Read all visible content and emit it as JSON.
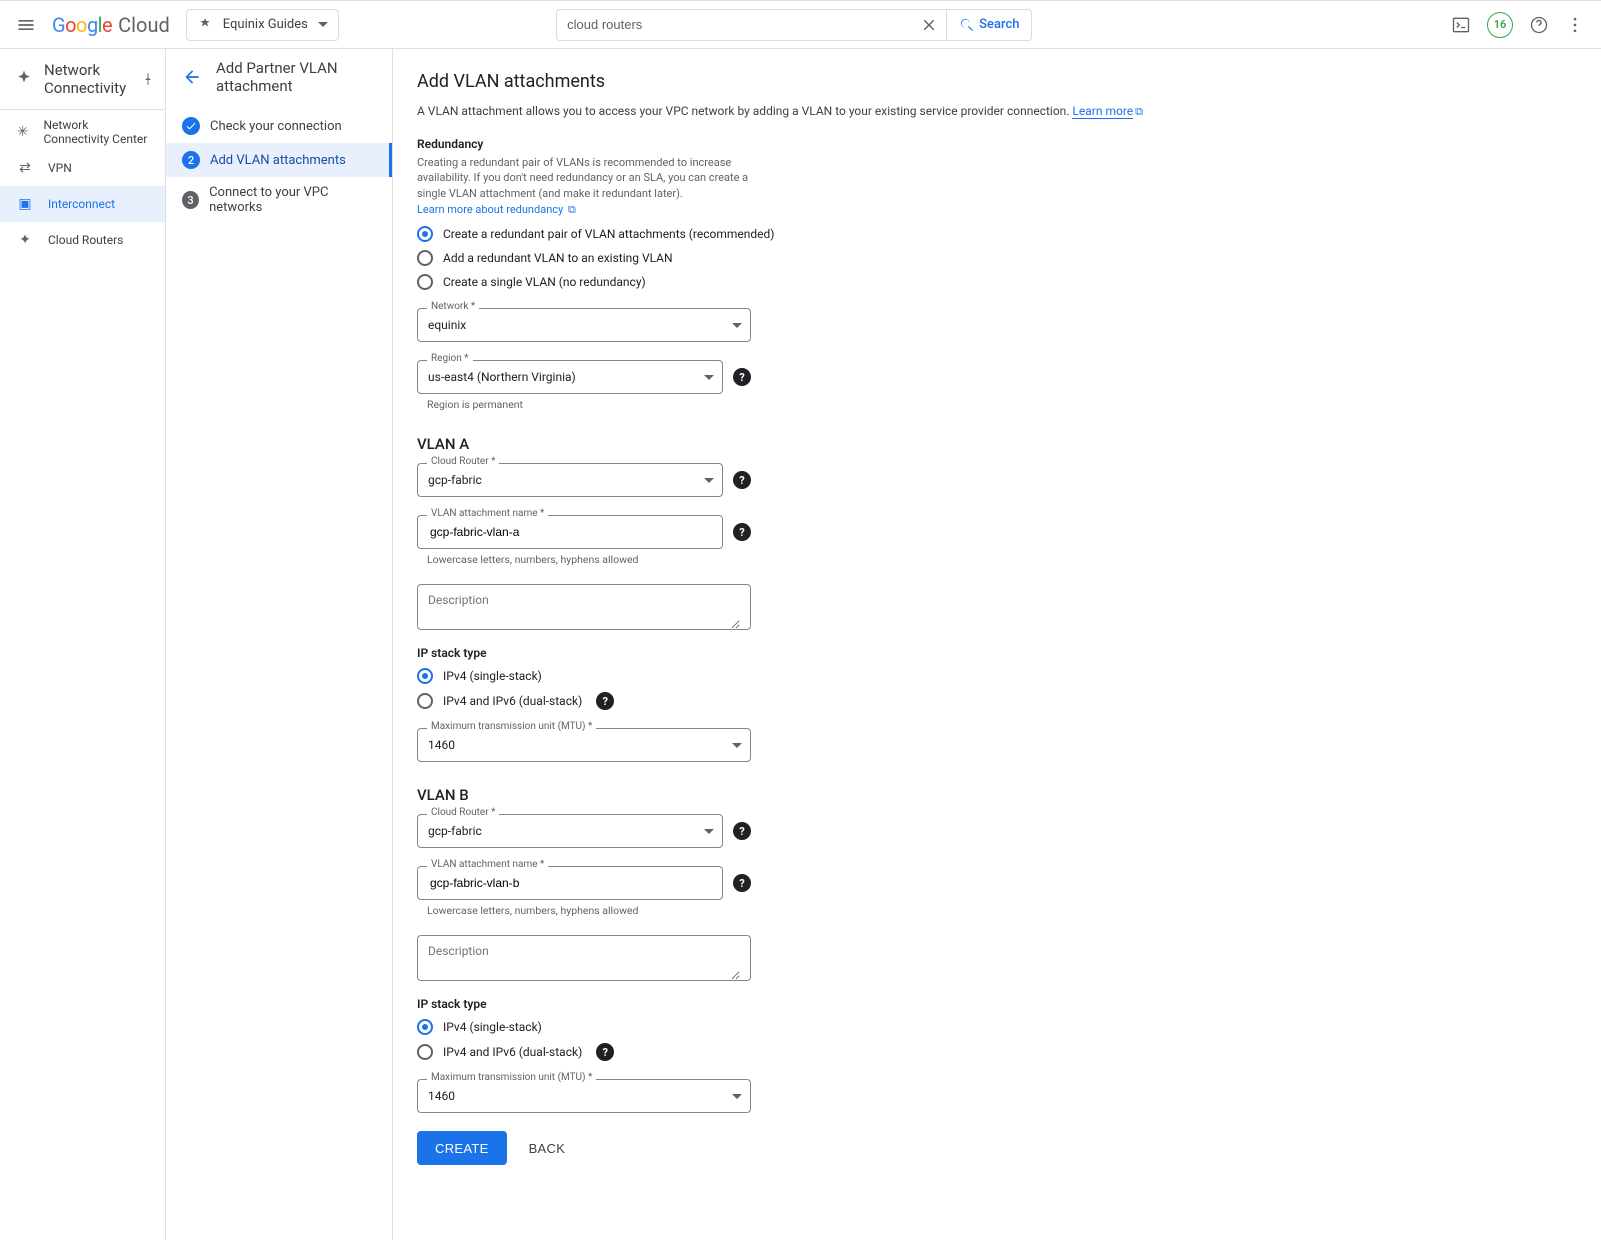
{
  "header": {
    "project_label": "Equinix Guides",
    "search_value": "cloud routers",
    "search_button": "Search",
    "badge_value": "16"
  },
  "side_nav": {
    "title": "Network Connectivity",
    "items": [
      {
        "label": "Network Connectivity Center"
      },
      {
        "label": "VPN"
      },
      {
        "label": "Interconnect"
      },
      {
        "label": "Cloud Routers"
      }
    ]
  },
  "stepper": {
    "title": "Add Partner VLAN attachment",
    "steps": [
      {
        "label": "Check your connection",
        "badge": "✓"
      },
      {
        "label": "Add VLAN attachments",
        "badge": "2"
      },
      {
        "label": "Connect to your VPC networks",
        "badge": "3"
      }
    ]
  },
  "page": {
    "title": "Add VLAN attachments",
    "subtitle": "A VLAN attachment allows you to access your VPC network by adding a VLAN to your existing service provider connection.",
    "learn_more": "Learn more",
    "redundancy_heading": "Redundancy",
    "redundancy_desc": "Creating a redundant pair of VLANs is recommended to increase availability. If you don't need redundancy or an SLA, you can create a single VLAN attachment (and make it redundant later).",
    "redundancy_link": "Learn more about redundancy",
    "radios": {
      "r1": "Create a redundant pair of VLAN attachments (recommended)",
      "r2": "Add a redundant VLAN to an existing VLAN",
      "r3": "Create a single VLAN (no redundancy)"
    },
    "network_label": "Network *",
    "network_value": "equinix",
    "region_label": "Region *",
    "region_value": "us-east4 (Northern Virginia)",
    "region_hint": "Region is permanent",
    "vlan_a_title": "VLAN A",
    "vlan_b_title": "VLAN B",
    "cloud_router_label": "Cloud Router *",
    "cloud_router_value": "gcp-fabric",
    "attach_name_label": "VLAN attachment name *",
    "attach_name_a": "gcp-fabric-vlan-a",
    "attach_name_b": "gcp-fabric-vlan-b",
    "name_hint": "Lowercase letters, numbers, hyphens allowed",
    "desc_placeholder": "Description",
    "ip_stack_heading": "IP stack type",
    "ip_v4": "IPv4 (single-stack)",
    "ip_dual": "IPv4 and IPv6 (dual-stack)",
    "mtu_label": "Maximum transmission unit (MTU) *",
    "mtu_value": "1460",
    "create_btn": "CREATE",
    "back_btn": "BACK"
  }
}
